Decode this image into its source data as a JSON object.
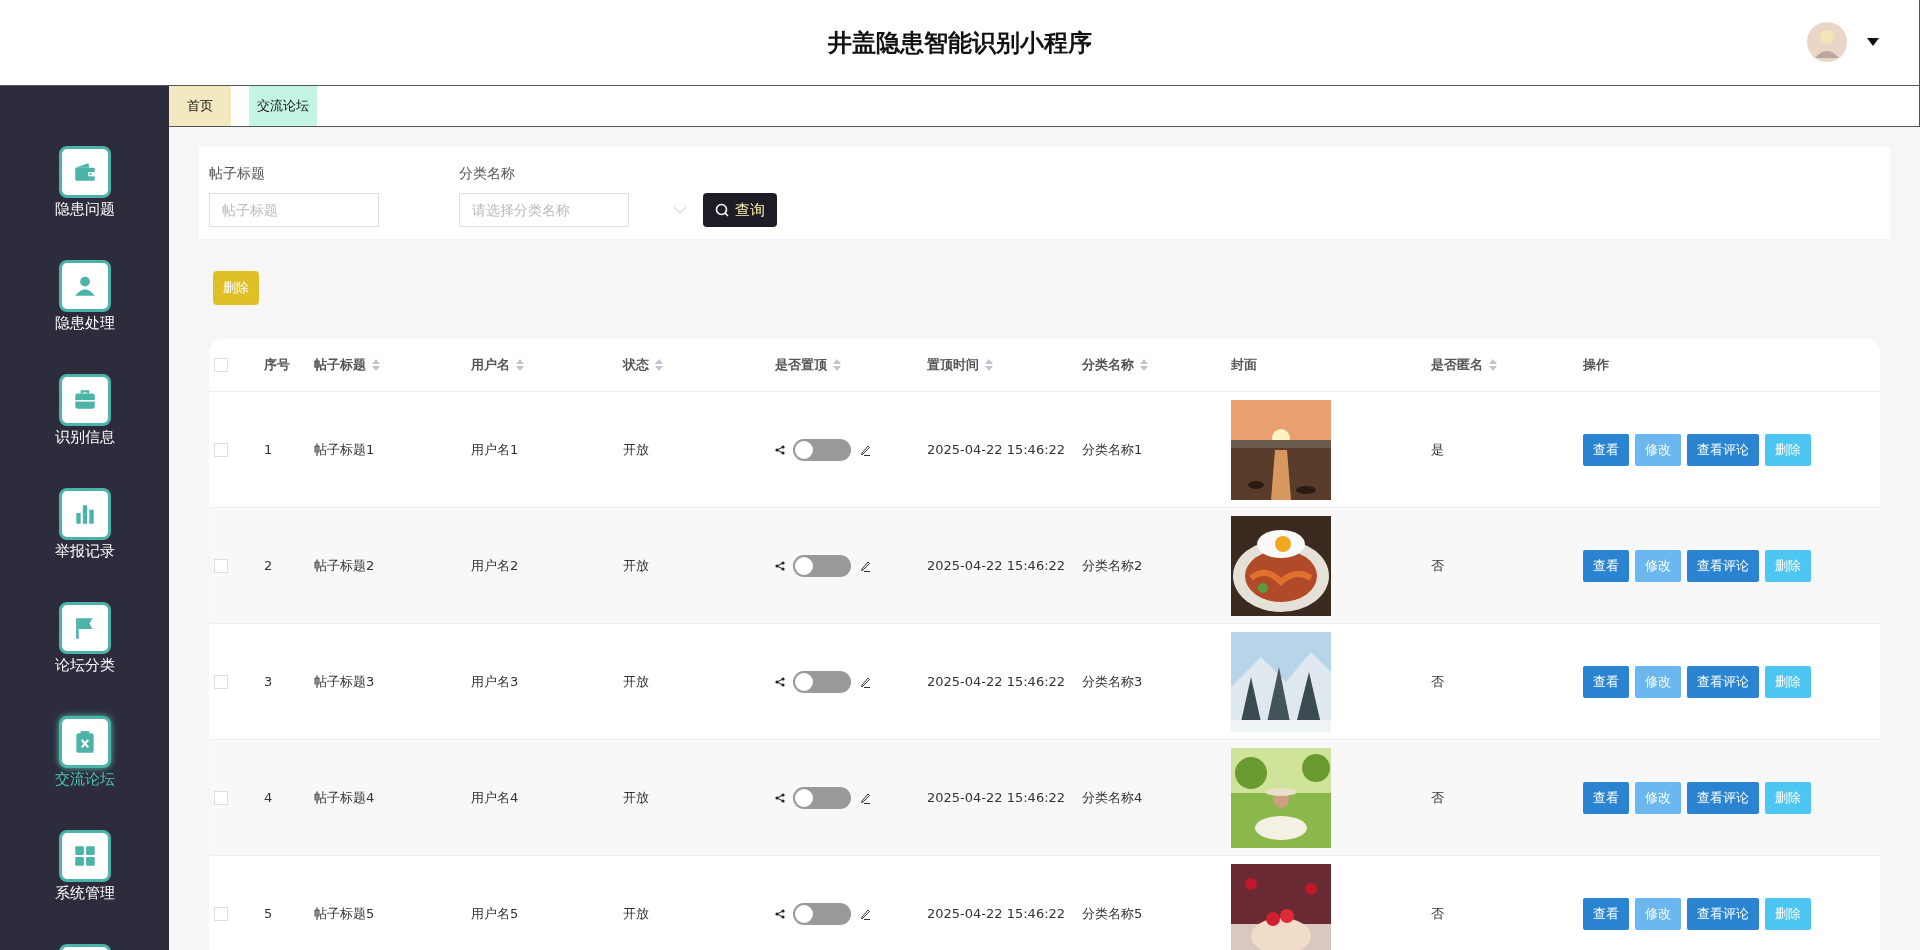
{
  "header": {
    "title": "井盖隐患智能识别小程序"
  },
  "sidebar": {
    "items": [
      {
        "label": "隐患问题",
        "selected": false
      },
      {
        "label": "隐患处理",
        "selected": false
      },
      {
        "label": "识别信息",
        "selected": false
      },
      {
        "label": "举报记录",
        "selected": false
      },
      {
        "label": "论坛分类",
        "selected": false
      },
      {
        "label": "交流论坛",
        "selected": true
      },
      {
        "label": "系统管理",
        "selected": false
      },
      {
        "selected": false
      }
    ]
  },
  "tabs": [
    {
      "label": "首页",
      "color": "#f3e9c0"
    },
    {
      "label": "交流论坛",
      "color": "#c4f5e4"
    }
  ],
  "search": {
    "fields": [
      {
        "kind": "text",
        "label": "帖子标题",
        "placeholder": "帖子标题"
      },
      {
        "kind": "select",
        "label": "分类名称",
        "placeholder": "请选择分类名称"
      }
    ],
    "button": "查询"
  },
  "delete_button": "删除",
  "table": {
    "select_all": {
      "checked": false
    },
    "columns": [
      {
        "label": "序号",
        "sortable": false
      },
      {
        "label": "帖子标题",
        "sortable": true
      },
      {
        "label": "用户名",
        "sortable": true
      },
      {
        "label": "状态",
        "sortable": true
      },
      {
        "label": "是否置顶",
        "sortable": true
      },
      {
        "label": "置顶时间",
        "sortable": true
      },
      {
        "label": "分类名称",
        "sortable": true
      },
      {
        "label": "封面",
        "sortable": false
      },
      {
        "label": "是否匿名",
        "sortable": true
      },
      {
        "label": "操作",
        "sortable": false
      }
    ],
    "rows": [
      {
        "checked": false,
        "index": "1",
        "title": "帖子标题1",
        "user": "用户名1",
        "status": "开放",
        "pinned": false,
        "time": "2025-04-22 15:46:22",
        "category": "分类名称1",
        "cover": {
          "kind": "picture"
        },
        "anonymous": "是",
        "actions": [
          {
            "kind": "view",
            "label": "查看"
          },
          {
            "kind": "edit",
            "label": "修改"
          },
          {
            "kind": "comments",
            "label": "查看评论"
          },
          {
            "kind": "delete",
            "label": "删除"
          }
        ]
      },
      {
        "checked": false,
        "index": "2",
        "title": "帖子标题2",
        "user": "用户名2",
        "status": "开放",
        "pinned": false,
        "time": "2025-04-22 15:46:22",
        "category": "分类名称2",
        "cover": {
          "kind": "picture"
        },
        "anonymous": "否",
        "actions": [
          {
            "kind": "view",
            "label": "查看"
          },
          {
            "kind": "edit",
            "label": "修改"
          },
          {
            "kind": "comments",
            "label": "查看评论"
          },
          {
            "kind": "delete",
            "label": "删除"
          }
        ]
      },
      {
        "checked": false,
        "index": "3",
        "title": "帖子标题3",
        "user": "用户名3",
        "status": "开放",
        "pinned": false,
        "time": "2025-04-22 15:46:22",
        "category": "分类名称3",
        "cover": {
          "kind": "picture"
        },
        "anonymous": "否",
        "actions": [
          {
            "kind": "view",
            "label": "查看"
          },
          {
            "kind": "edit",
            "label": "修改"
          },
          {
            "kind": "comments",
            "label": "查看评论"
          },
          {
            "kind": "delete",
            "label": "删除"
          }
        ]
      },
      {
        "checked": false,
        "index": "4",
        "title": "帖子标题4",
        "user": "用户名4",
        "status": "开放",
        "pinned": false,
        "time": "2025-04-22 15:46:22",
        "category": "分类名称4",
        "cover": {
          "kind": "picture"
        },
        "anonymous": "否",
        "actions": [
          {
            "kind": "view",
            "label": "查看"
          },
          {
            "kind": "edit",
            "label": "修改"
          },
          {
            "kind": "comments",
            "label": "查看评论"
          },
          {
            "kind": "delete",
            "label": "删除"
          }
        ]
      },
      {
        "checked": false,
        "index": "5",
        "title": "帖子标题5",
        "user": "用户名5",
        "status": "开放",
        "pinned": false,
        "time": "2025-04-22 15:46:22",
        "category": "分类名称5",
        "cover": {
          "kind": "picture"
        },
        "anonymous": "否",
        "actions": [
          {
            "kind": "view",
            "label": "查看"
          },
          {
            "kind": "edit",
            "label": "修改"
          },
          {
            "kind": "comments",
            "label": "查看评论"
          },
          {
            "kind": "delete",
            "label": "删除"
          }
        ]
      }
    ]
  }
}
